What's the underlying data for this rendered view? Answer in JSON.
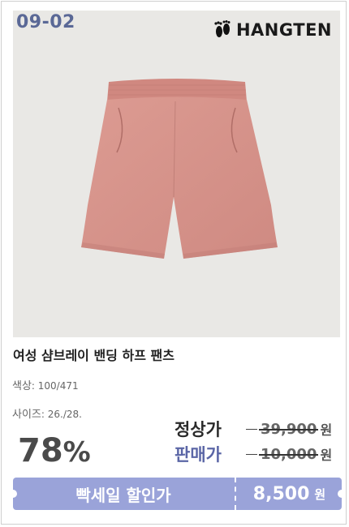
{
  "badge_code": "09-02",
  "brand": {
    "name": "HANGTEN",
    "logo_icon": "footprints-icon"
  },
  "product": {
    "title": "여성 샴브레이 밴딩 하프 팬츠",
    "color_label": "색상",
    "color_value": ": 100/471",
    "size_label": "사이즈",
    "size_value": ": 26./28.",
    "image_color": "#d7928a"
  },
  "discount": {
    "value": "78",
    "unit": "%"
  },
  "prices": {
    "regular_label": "정상가",
    "regular_value": "39,900",
    "sale_label": "판매가",
    "sale_value": "10,000",
    "currency": "원"
  },
  "deal_bar": {
    "label": "빡세일 할인가",
    "price": "8,500",
    "currency": "원",
    "color": "#9aa3d9"
  }
}
